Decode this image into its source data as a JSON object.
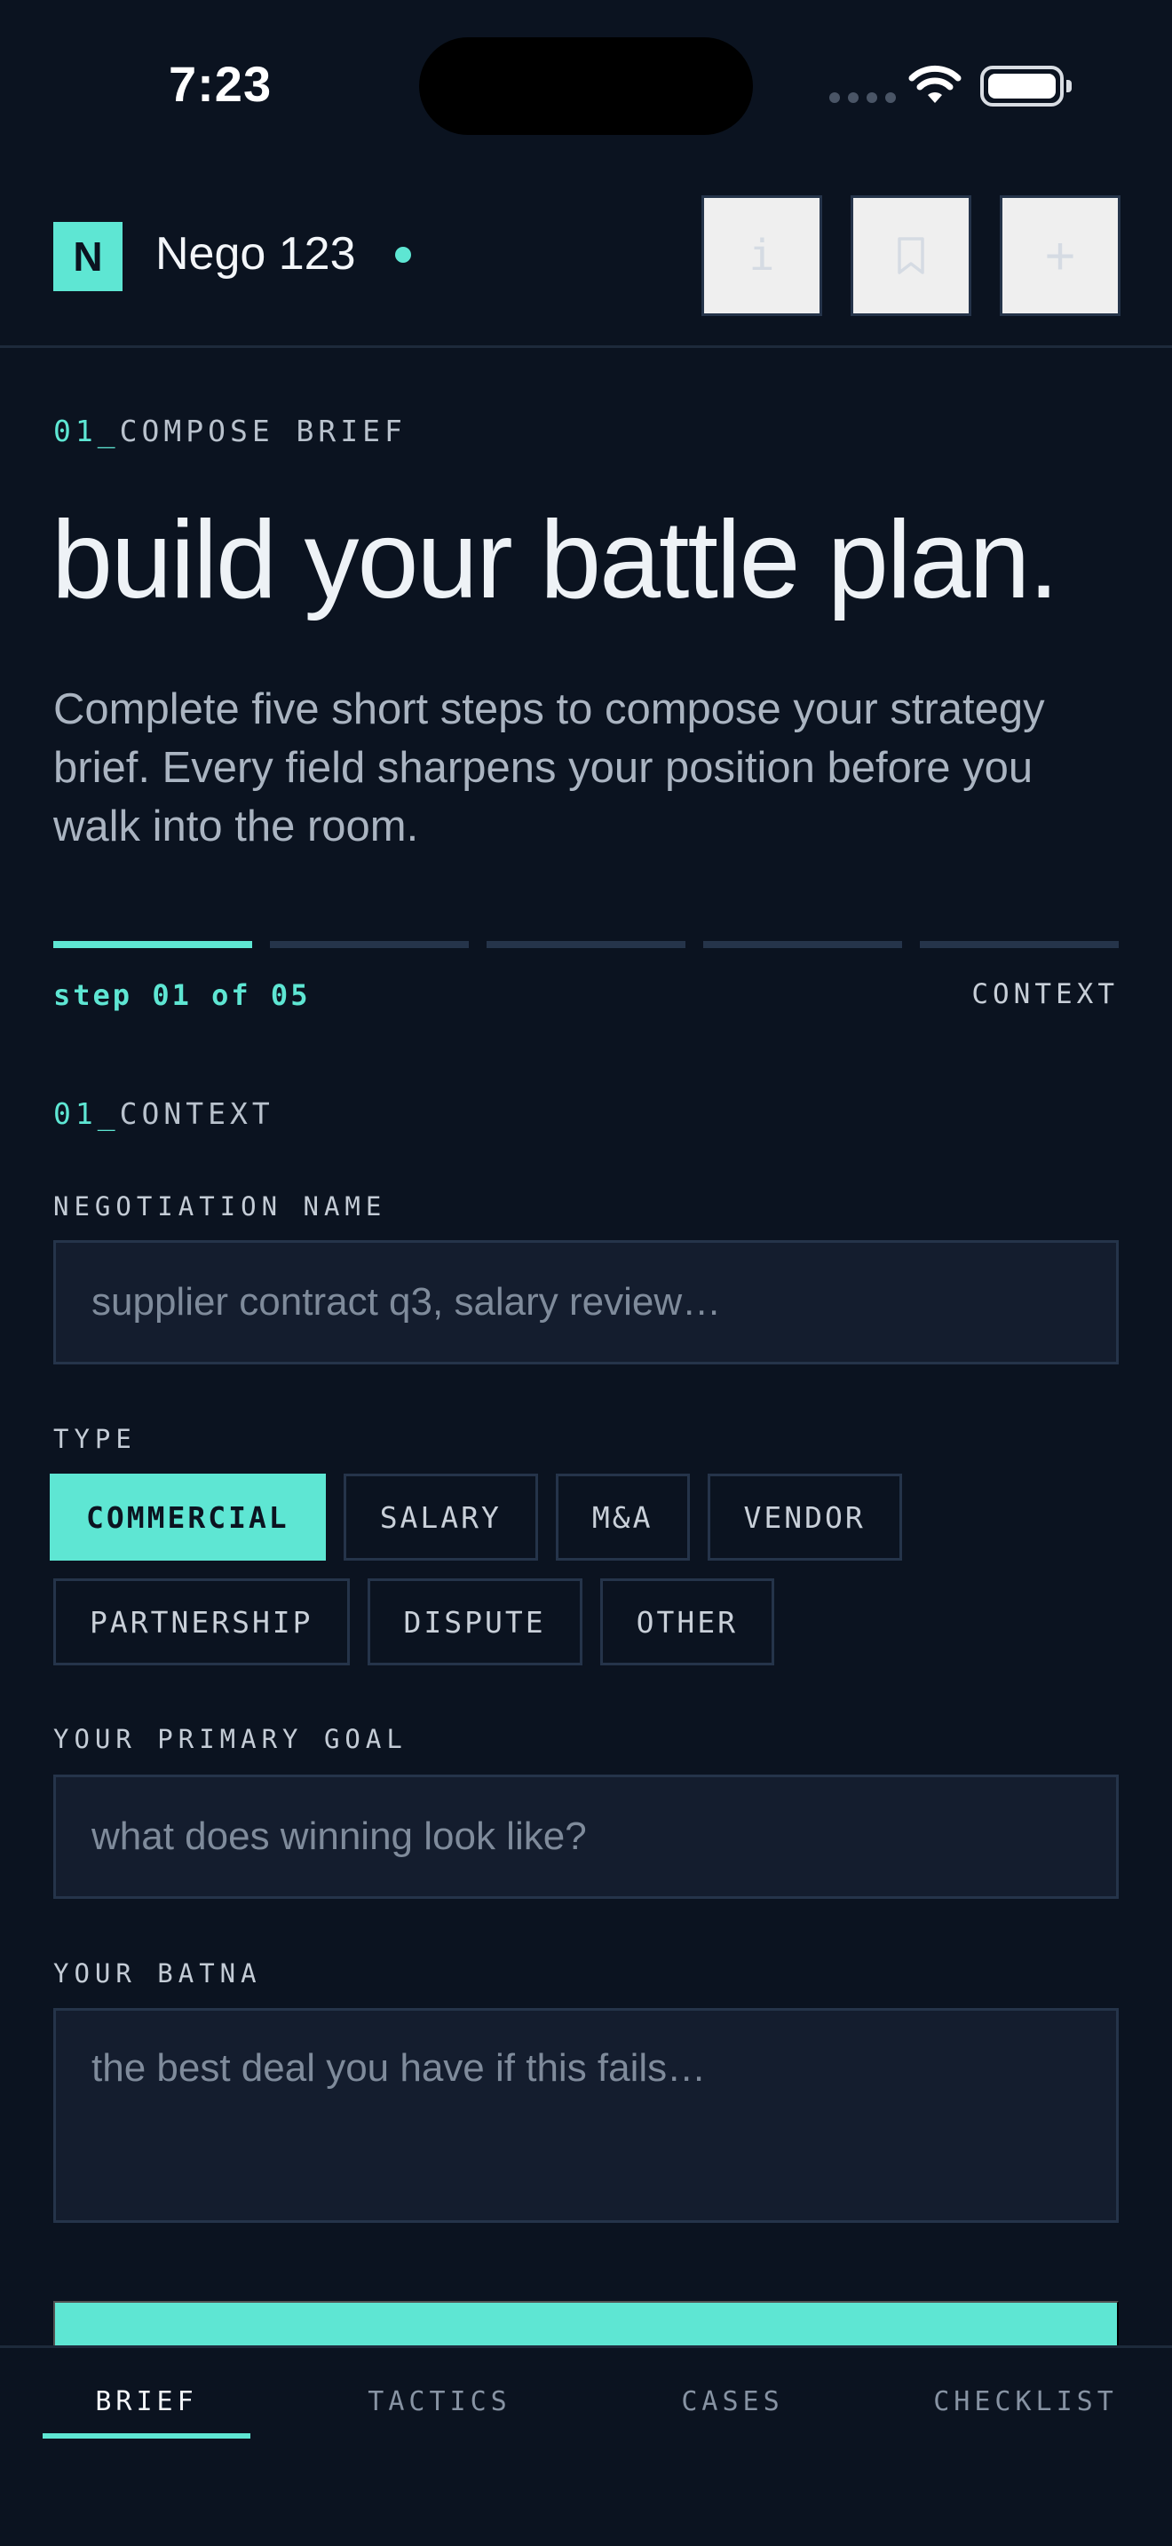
{
  "status_bar": {
    "time": "7:23"
  },
  "header": {
    "logo_letter": "N",
    "title": "Nego 123",
    "info_label": "i",
    "add_label": "+",
    "icons": {
      "info": "info-icon",
      "bookmark": "bookmark-icon",
      "add": "plus-icon"
    }
  },
  "hero": {
    "kicker_number": "01_",
    "kicker_text": "COMPOSE BRIEF",
    "headline": "build your battle plan.",
    "intro": "Complete five short steps to compose your strategy brief. Every field sharpens your position before you walk into the room."
  },
  "progress": {
    "current_step": 1,
    "total_steps": 5,
    "step_label": "step 01 of 05",
    "step_name": "CONTEXT"
  },
  "form": {
    "kicker_number": "01_",
    "kicker_text": "CONTEXT",
    "negotiation_name": {
      "label": "NEGOTIATION NAME",
      "placeholder": "supplier contract q3, salary review…",
      "value": ""
    },
    "type": {
      "label": "TYPE",
      "options": [
        "COMMERCIAL",
        "SALARY",
        "M&A",
        "VENDOR",
        "PARTNERSHIP",
        "DISPUTE",
        "OTHER"
      ],
      "selected": "COMMERCIAL"
    },
    "primary_goal": {
      "label": "YOUR PRIMARY GOAL",
      "placeholder": "what does winning look like?",
      "value": ""
    },
    "batna": {
      "label": "YOUR BATNA",
      "placeholder": "the best deal you have if this fails…",
      "value": ""
    }
  },
  "bottom_nav": {
    "tabs": [
      "BRIEF",
      "TACTICS",
      "CASES",
      "CHECKLIST"
    ],
    "active": "BRIEF"
  },
  "colors": {
    "accent": "#5ee6d3",
    "background": "#0b1320",
    "border": "#25344a",
    "field": "#141d2e"
  }
}
